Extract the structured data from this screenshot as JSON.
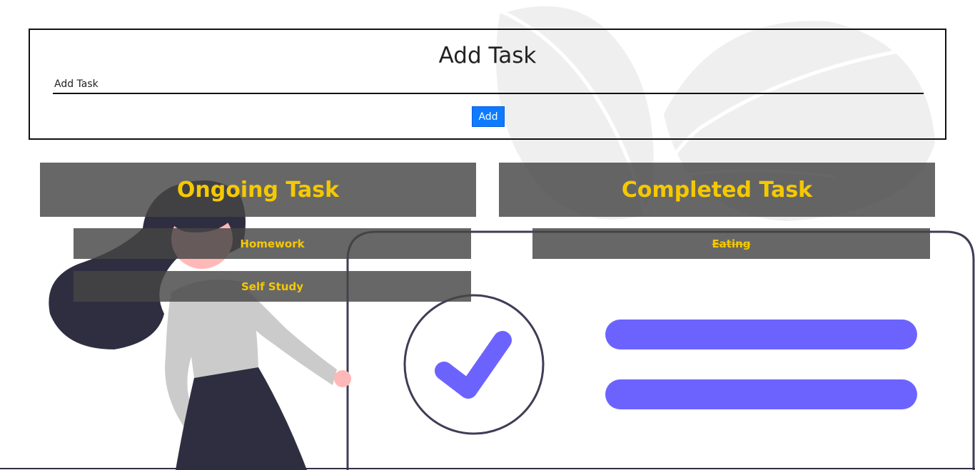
{
  "add_task": {
    "title": "Add Task",
    "input_placeholder": "Add Task",
    "input_value": "",
    "add_button_label": "Add",
    "button_color": "#0d7bff"
  },
  "ongoing": {
    "header": "Ongoing Task",
    "items": [
      {
        "label": "Homework"
      },
      {
        "label": "Self Study"
      }
    ]
  },
  "completed": {
    "header": "Completed Task",
    "items": [
      {
        "label": "Eating"
      }
    ]
  },
  "colors": {
    "accent": "#f5c900",
    "panel": "#464646",
    "illustration_purple": "#6c63ff",
    "illustration_dark": "#2f2e41"
  },
  "illustration": {
    "icon": "checkmark-icon",
    "figure": "woman-figure"
  }
}
